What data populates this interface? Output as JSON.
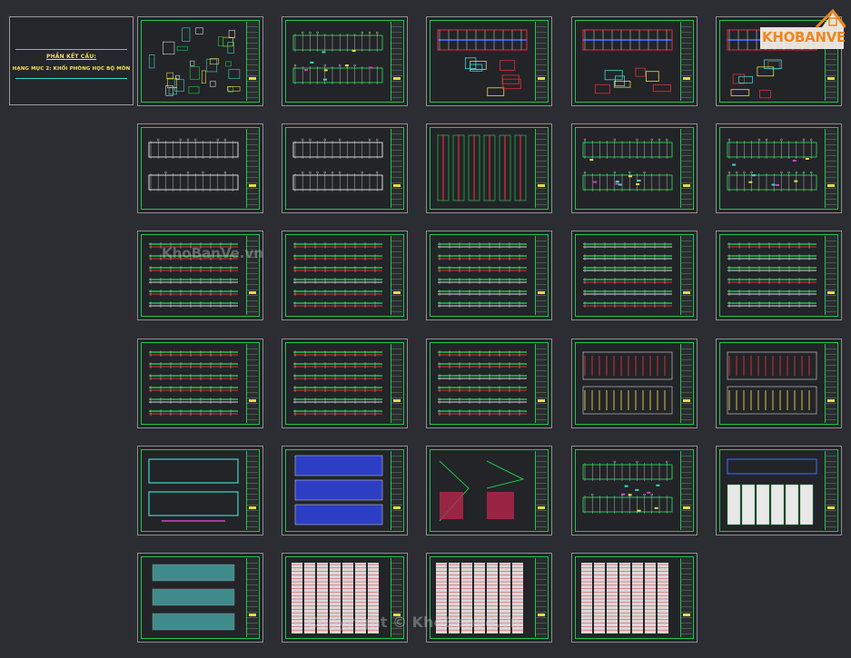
{
  "cover": {
    "title": "PHẦN KẾT CẤU:",
    "subtitle": "HẠNG MỤC 2: KHỐI PHÒNG HỌC BỘ MÔN"
  },
  "logo": {
    "word_part1": "KHO",
    "word_part2": "BANVE",
    "colors": {
      "orange": "#f0861e",
      "light": "#f7f3ea"
    }
  },
  "watermarks": [
    "KhoBanVe.vn",
    "Copyright © KhoBanVe.vn"
  ],
  "colors": {
    "background": "#2b2d33",
    "frame_green": "#21c44a",
    "title_yellow": "#f3e25a",
    "cyan": "#3fd6c8"
  },
  "sheets": [
    {
      "row": 0,
      "col": 0,
      "style": "details"
    },
    {
      "row": 0,
      "col": 1,
      "style": "plan"
    },
    {
      "row": 0,
      "col": 2,
      "style": "red"
    },
    {
      "row": 0,
      "col": 3,
      "style": "red"
    },
    {
      "row": 0,
      "col": 4,
      "style": "red"
    },
    {
      "row": 1,
      "col": 0,
      "style": "grid"
    },
    {
      "row": 1,
      "col": 1,
      "style": "grid"
    },
    {
      "row": 1,
      "col": 2,
      "style": "columns"
    },
    {
      "row": 1,
      "col": 3,
      "style": "plan"
    },
    {
      "row": 1,
      "col": 4,
      "style": "plan"
    },
    {
      "row": 2,
      "col": 0,
      "style": "beams"
    },
    {
      "row": 2,
      "col": 1,
      "style": "beams"
    },
    {
      "row": 2,
      "col": 2,
      "style": "beams"
    },
    {
      "row": 2,
      "col": 3,
      "style": "beams"
    },
    {
      "row": 2,
      "col": 4,
      "style": "beams"
    },
    {
      "row": 3,
      "col": 0,
      "style": "beams"
    },
    {
      "row": 3,
      "col": 1,
      "style": "beams"
    },
    {
      "row": 3,
      "col": 2,
      "style": "beams"
    },
    {
      "row": 3,
      "col": 3,
      "style": "slab"
    },
    {
      "row": 3,
      "col": 4,
      "style": "slab"
    },
    {
      "row": 4,
      "col": 0,
      "style": "cyan"
    },
    {
      "row": 4,
      "col": 1,
      "style": "blue"
    },
    {
      "row": 4,
      "col": 2,
      "style": "stairs"
    },
    {
      "row": 4,
      "col": 3,
      "style": "plan"
    },
    {
      "row": 4,
      "col": 4,
      "style": "table"
    },
    {
      "row": 5,
      "col": 0,
      "style": "roof"
    },
    {
      "row": 5,
      "col": 1,
      "style": "schedule"
    },
    {
      "row": 5,
      "col": 2,
      "style": "schedule"
    },
    {
      "row": 5,
      "col": 3,
      "style": "schedule"
    }
  ]
}
